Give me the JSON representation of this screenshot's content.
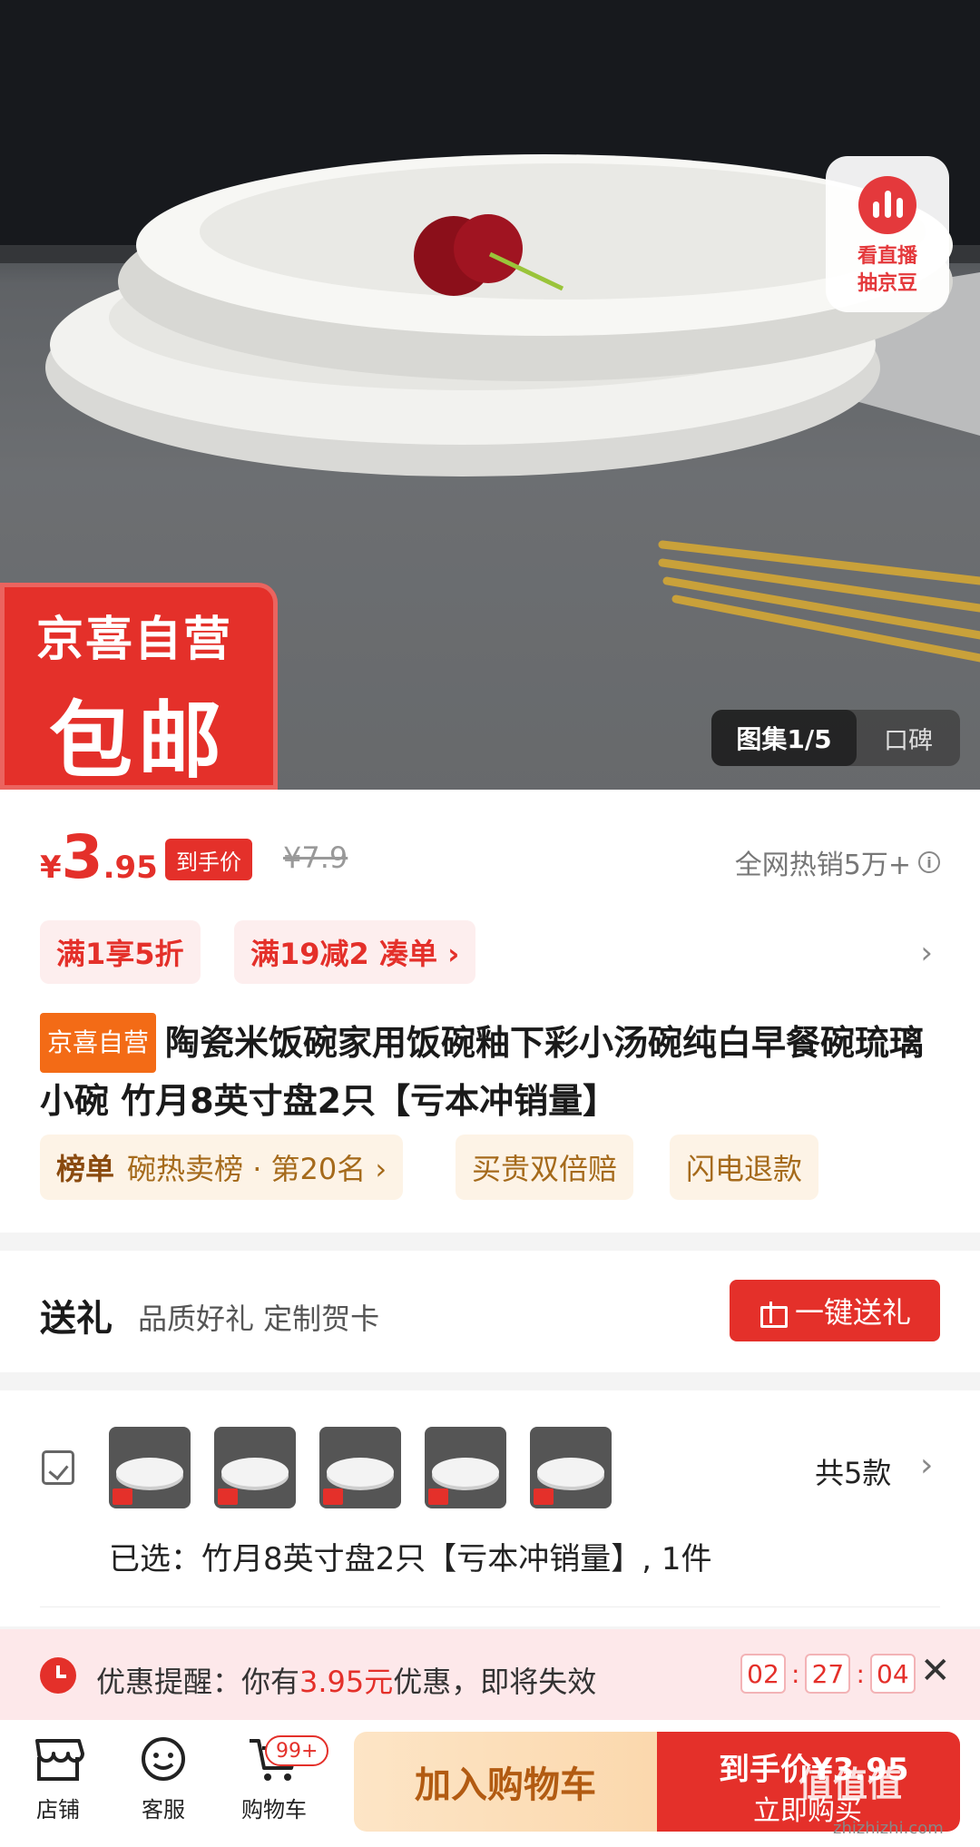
{
  "hero": {
    "live_button": {
      "line1": "看直播",
      "line2": "抽京豆"
    },
    "badge": {
      "line1": "京喜自营",
      "line2": "包邮"
    },
    "gallery": {
      "current": "图集1/5",
      "reviews": "口碑"
    }
  },
  "price": {
    "currency": "¥",
    "integer": "3",
    "decimal": ".95",
    "final_tag": "到手价",
    "original": "¥7.9",
    "hot_sale": "全网热销5万+",
    "info_icon": "i"
  },
  "promos": [
    {
      "label": "满1享5折"
    },
    {
      "label": "满19减2  凑单 ›"
    }
  ],
  "promos_chevron": "›",
  "product": {
    "store_tag": "京喜自营",
    "title": "陶瓷米饭碗家用饭碗釉下彩小汤碗纯白早餐碗琉璃小碗 竹月8英寸盘2只【亏本冲销量】"
  },
  "tags": [
    {
      "bold": "榜单",
      "text": "碗热卖榜 · 第20名 ›"
    },
    {
      "bold": "",
      "text": "买贵双倍赔"
    },
    {
      "bold": "",
      "text": "闪电退款"
    }
  ],
  "gift": {
    "title": "送礼",
    "subtitle": "品质好礼 定制贺卡",
    "button": "一键送礼"
  },
  "variants": {
    "count": "共5款",
    "chevron": "›",
    "selected": "已选：竹月8英寸盘2只【亏本冲销量】, 1件"
  },
  "reminder": {
    "prefix": "优惠提醒：你有",
    "amount": "3.95元",
    "suffix": "优惠，即将失效",
    "hours": "02",
    "minutes": "27",
    "seconds": "04",
    "close": "✕"
  },
  "bottom": {
    "store": "店铺",
    "service": "客服",
    "cart": "购物车",
    "cart_badge": "99+",
    "add_to_cart": "加入购物车",
    "buy_line1": "到手价¥3.95",
    "buy_line2": "立即购买"
  },
  "watermark": {
    "main": "值值值",
    "url": "zhizhizhi.com"
  },
  "colors": {
    "accent": "#e4302a",
    "orange": "#f36b16",
    "gold": "#a56a1b"
  }
}
